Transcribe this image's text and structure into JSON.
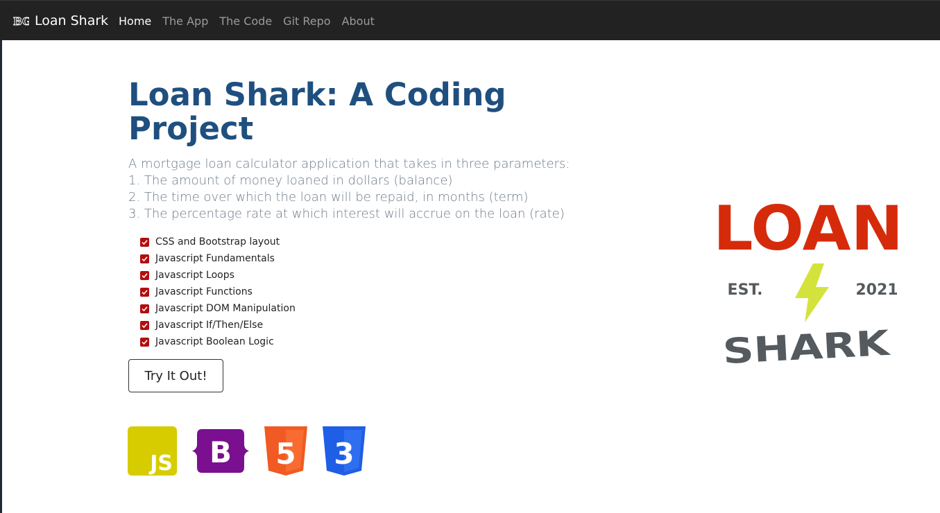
{
  "navbar": {
    "brand_mark": "BG",
    "brand": "Loan Shark",
    "links": [
      {
        "label": "Home",
        "active": true
      },
      {
        "label": "The App",
        "active": false
      },
      {
        "label": "The Code",
        "active": false
      },
      {
        "label": "Git Repo",
        "active": false
      },
      {
        "label": "About",
        "active": false
      }
    ]
  },
  "hero": {
    "title": "Loan Shark: A Coding Project",
    "description": [
      "A mortgage loan calculator application that takes in three parameters:",
      "1. The amount of money loaned in dollars (balance)",
      "2. The time over which the loan will be repaid, in months (term)",
      "3. The percentage rate at which interest will accrue on the loan (rate)"
    ]
  },
  "checklist": [
    "CSS and Bootstrap layout",
    "Javascript Fundamentals",
    "Javascript Loops",
    "Javascript Functions",
    "Javascript DOM Manipulation",
    "Javascript If/Then/Else",
    "Javascript Boolean Logic"
  ],
  "cta": {
    "label": "Try It Out!"
  },
  "tech_icons": [
    {
      "name": "javascript-icon",
      "text": "JS",
      "color": "#d6cc00"
    },
    {
      "name": "bootstrap-icon",
      "text": "B",
      "color": "#7a0f8f"
    },
    {
      "name": "html5-icon",
      "text": "5",
      "color": "#f15a22"
    },
    {
      "name": "css3-icon",
      "text": "3",
      "color": "#1f5ee6"
    }
  ],
  "logo": {
    "line1": "LOAN",
    "est": "EST.",
    "year": "2021",
    "line2": "SHARK",
    "red": "#d62b0b",
    "bolt": "#d4e33b",
    "gray": "#545a5e"
  },
  "colors": {
    "navbar_bg": "#222222",
    "title": "#1f4f7f",
    "check": "#b30d0d"
  }
}
